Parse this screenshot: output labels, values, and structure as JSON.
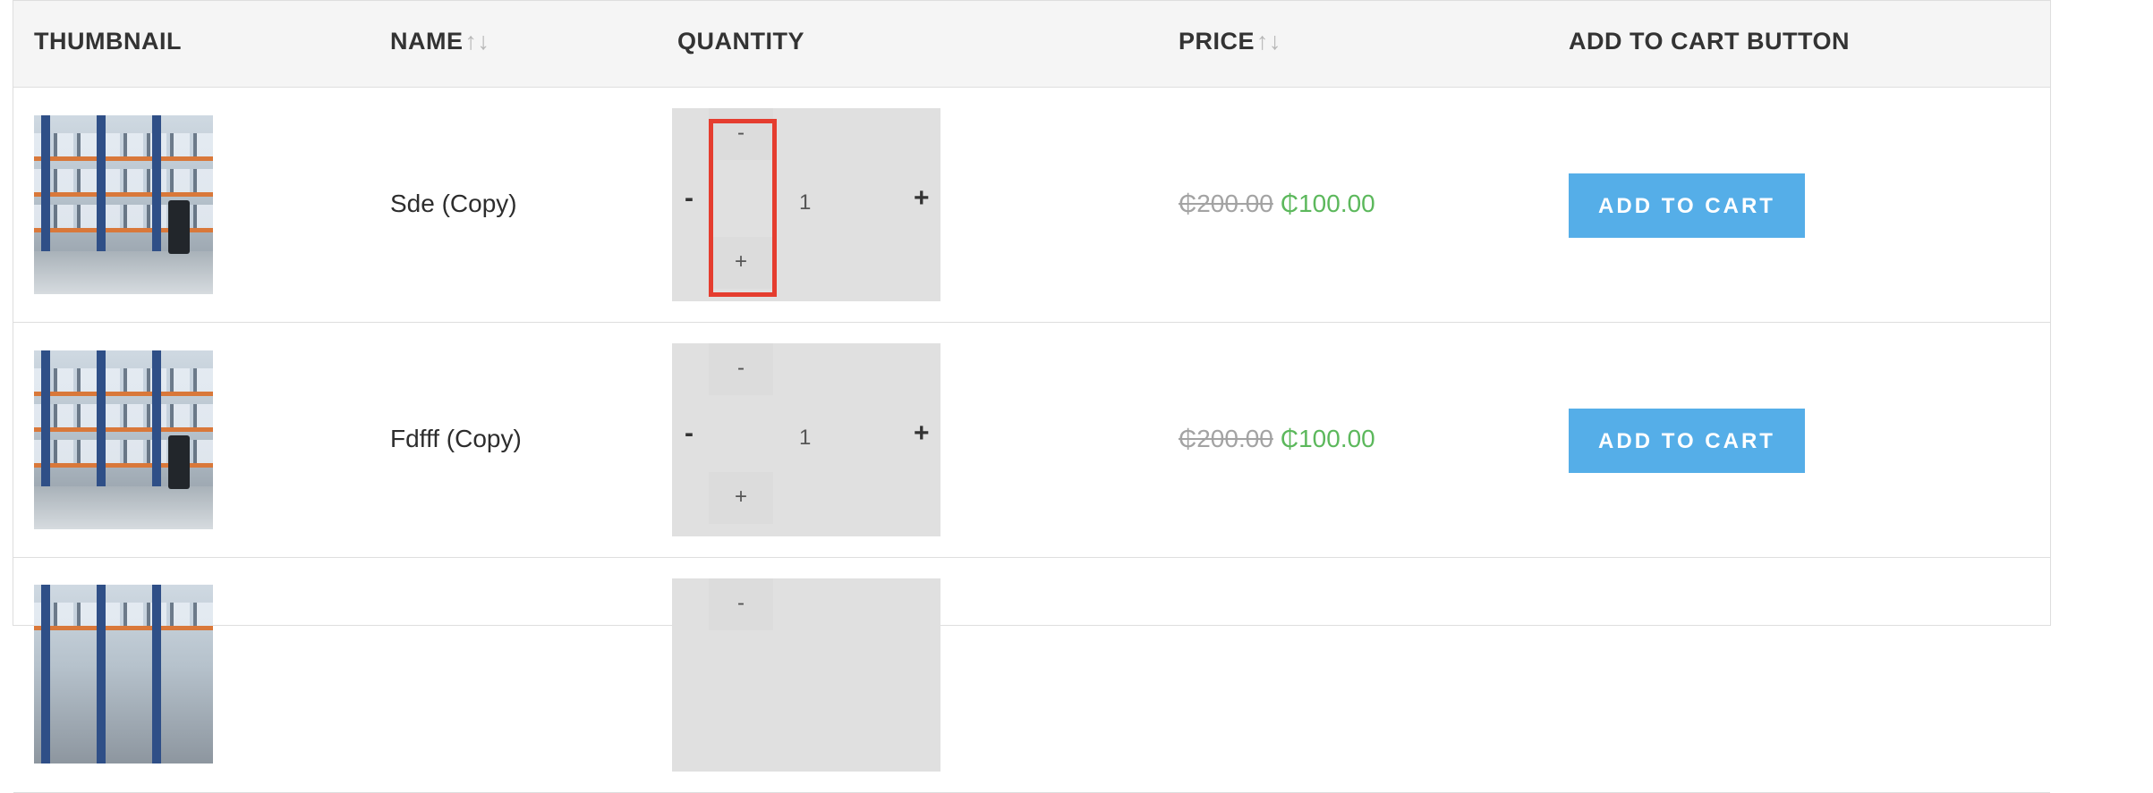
{
  "table": {
    "headers": {
      "thumbnail": "THUMBNAIL",
      "name": "NAME",
      "quantity": "QUANTITY",
      "price": "PRICE",
      "add_to_cart": "ADD TO CART BUTTON"
    },
    "sort_arrows": {
      "up": "↑",
      "down": "↓"
    },
    "rows": [
      {
        "name": "Sde (Copy)",
        "quantity": {
          "value": "1",
          "minus": "-",
          "plus": "+",
          "small_minus": "-",
          "small_plus": "+"
        },
        "price": {
          "regular": "₵200.00",
          "sale": "₵100.00"
        },
        "button": "ADD TO CART"
      },
      {
        "name": "Fdfff (Copy)",
        "quantity": {
          "value": "1",
          "minus": "-",
          "plus": "+",
          "small_minus": "-",
          "small_plus": "+"
        },
        "price": {
          "regular": "₵200.00",
          "sale": "₵100.00"
        },
        "button": "ADD TO CART"
      },
      {
        "name": "",
        "quantity": {
          "value": "",
          "minus": "",
          "plus": "",
          "small_minus": "-",
          "small_plus": ""
        },
        "price": {
          "regular": "",
          "sale": ""
        },
        "button": ""
      }
    ]
  },
  "colors": {
    "accent_button": "#55aee8",
    "sale_price": "#5cb85c",
    "highlight_box": "#e53d2f",
    "header_bg": "#f5f5f5"
  },
  "icons": [
    "sort-arrows-icon",
    "product-thumbnail-warehouse"
  ]
}
